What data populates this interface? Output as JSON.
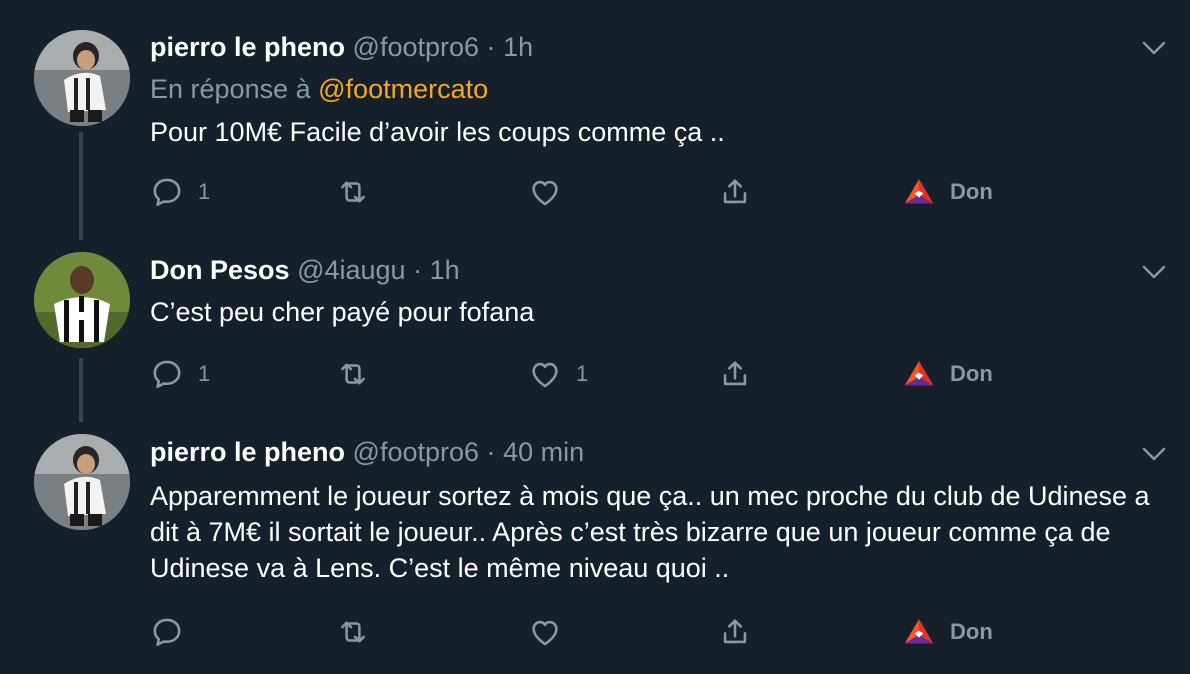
{
  "tweets": [
    {
      "name": "pierro le pheno",
      "handle": "@footpro6",
      "sep": "·",
      "time": "1h",
      "reply_prefix": "En réponse à",
      "reply_mention": "@footmercato",
      "text": "Pour 10M€ Facile d’avoir les coups comme ça ..",
      "reply_count": "1",
      "like_count": "",
      "don_label": "Don"
    },
    {
      "name": "Don Pesos",
      "handle": "@4iaugu",
      "sep": "·",
      "time": "1h",
      "text": "C’est peu cher payé pour fofana",
      "reply_count": "1",
      "like_count": "1",
      "don_label": "Don"
    },
    {
      "name": "pierro le pheno",
      "handle": "@footpro6",
      "sep": "·",
      "time": "40 min",
      "text": "Apparemment le joueur sortez à mois que  ça.. un mec proche du club de Udinese a dit à 7M€ il sortait le joueur.. Après c’est très bizarre que un joueur comme ça de Udinese va à Lens. C’est le même niveau quoi ..",
      "reply_count": "",
      "like_count": "",
      "don_label": "Don"
    }
  ],
  "colors": {
    "background": "#15202b",
    "muted": "#8899a6",
    "mention": "#f5a623",
    "thread_line": "#38444d"
  },
  "icons": [
    "reply-icon",
    "retweet-icon",
    "like-icon",
    "share-icon",
    "brave-tip-icon",
    "chevron-down-icon"
  ]
}
